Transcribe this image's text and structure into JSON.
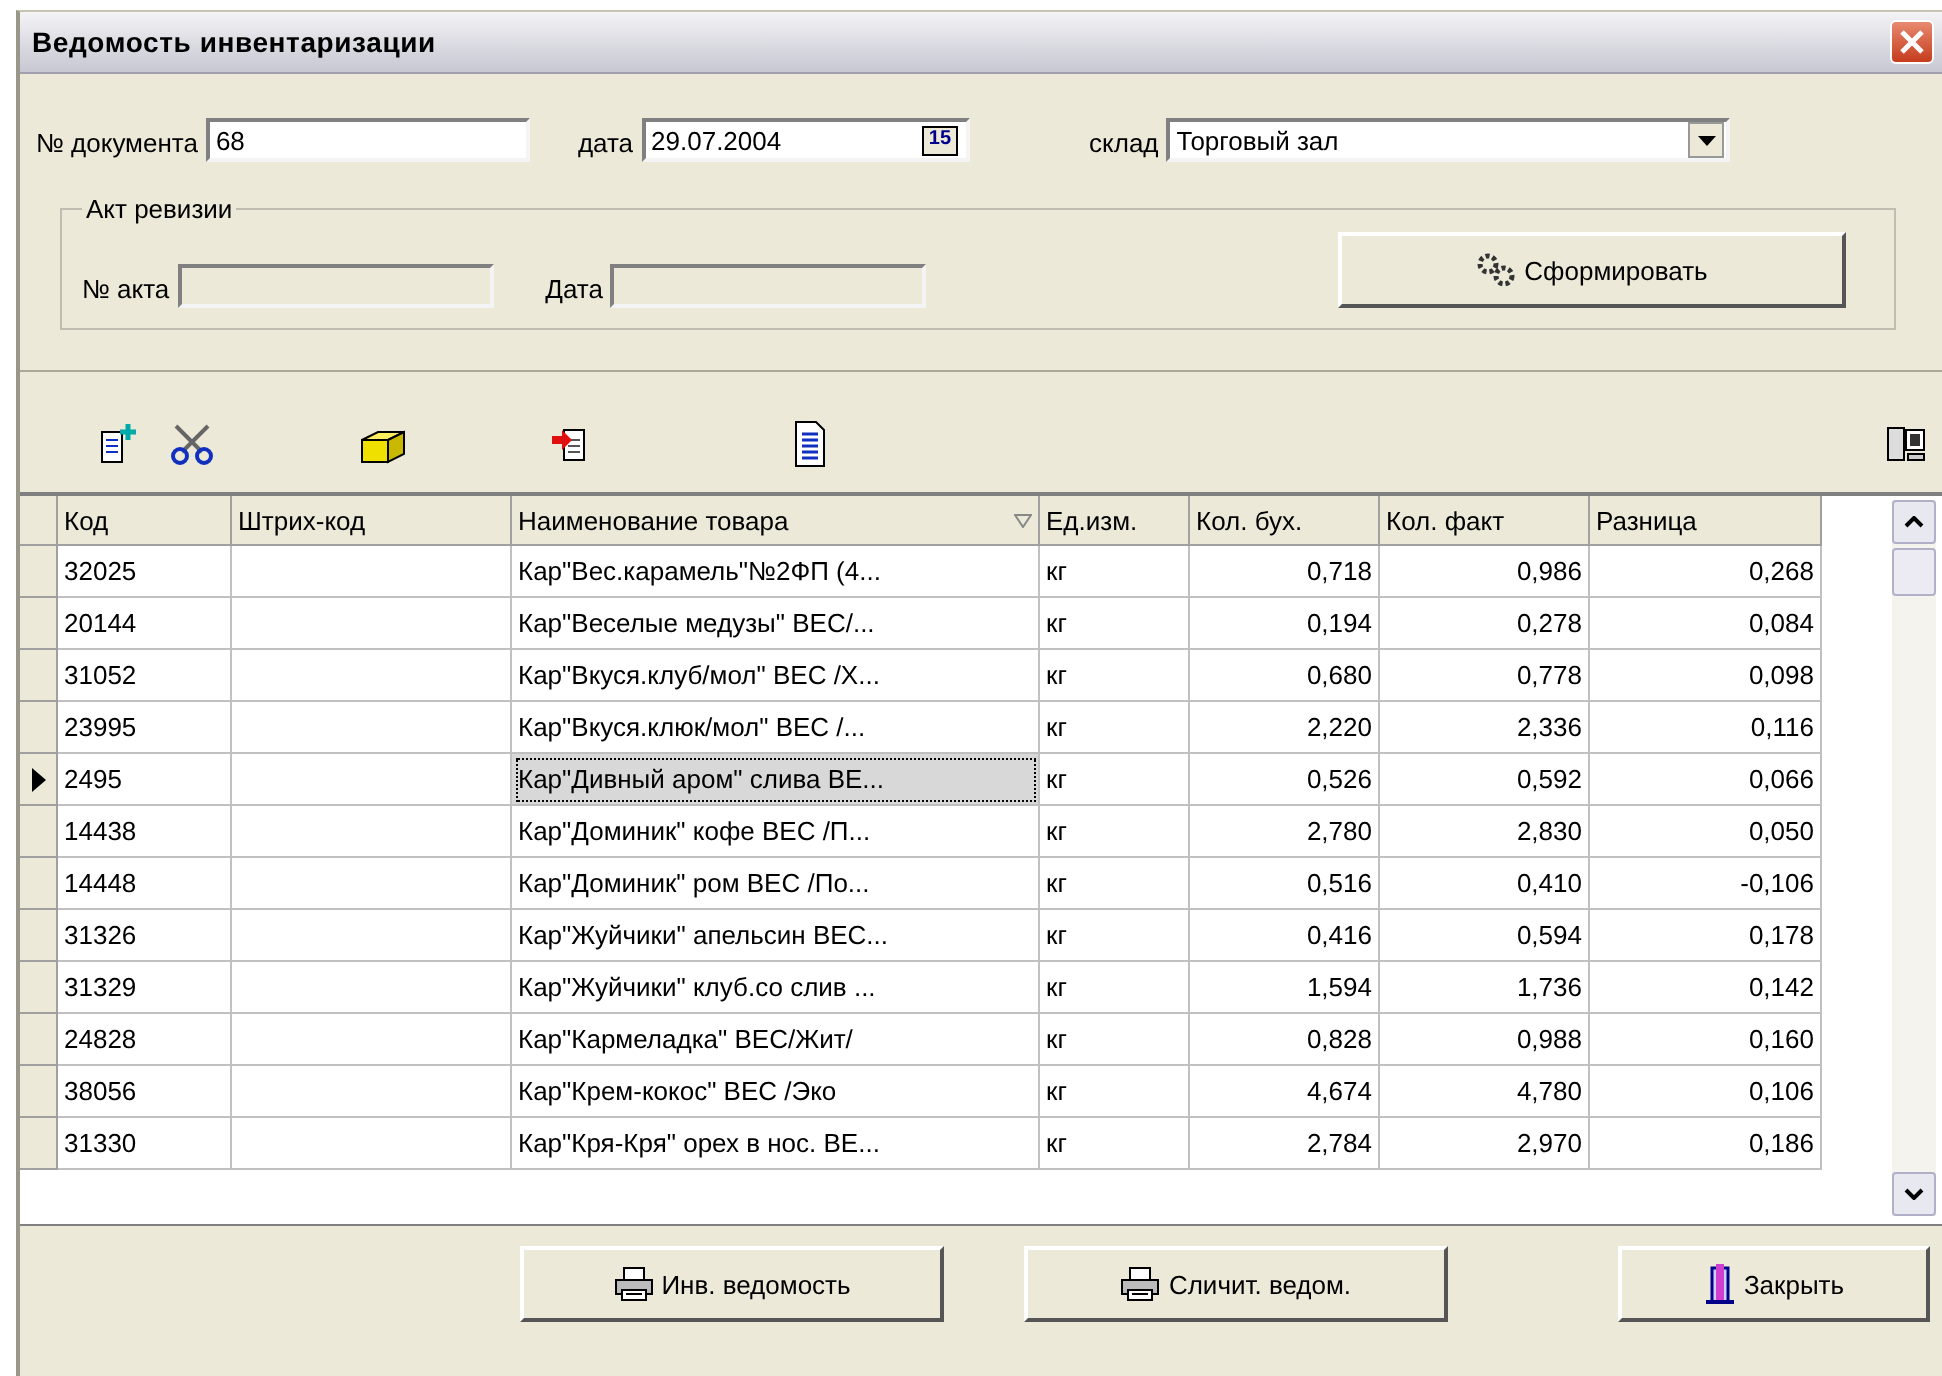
{
  "window": {
    "title": "Ведомость инвентаризации"
  },
  "header": {
    "doc_label": "№ документа",
    "doc_value": "68",
    "date_label": "дата",
    "date_value": "29.07.2004",
    "calendar_day": "15",
    "store_label": "склад",
    "store_value": "Торговый зал"
  },
  "audit": {
    "legend": "Акт ревизии",
    "act_label": "№ акта",
    "date_label": "Дата",
    "form_button": "Сформировать"
  },
  "table": {
    "columns": [
      {
        "label": "Код",
        "sorted": false
      },
      {
        "label": "Штрих-код",
        "sorted": false
      },
      {
        "label": "Наименование товара",
        "sorted": true
      },
      {
        "label": "Ед.изм.",
        "sorted": false
      },
      {
        "label": "Кол. бух.",
        "sorted": false
      },
      {
        "label": "Кол. факт",
        "sorted": false
      },
      {
        "label": "Разница",
        "sorted": false
      }
    ],
    "rows": [
      {
        "cells": [
          "32025",
          "",
          "Кар\"Вес.карамель\"№2ФП (4...",
          "кг",
          "0,718",
          "0,986",
          "0,268"
        ],
        "selected": false
      },
      {
        "cells": [
          "20144",
          "",
          "Кар\"Веселые медузы\" ВЕС/...",
          "кг",
          "0,194",
          "0,278",
          "0,084"
        ],
        "selected": false
      },
      {
        "cells": [
          "31052",
          "",
          "Кар\"Вкуся.клуб/мол\" ВЕС /Х...",
          "кг",
          "0,680",
          "0,778",
          "0,098"
        ],
        "selected": false
      },
      {
        "cells": [
          "23995",
          "",
          "Кар\"Вкуся.клюк/мол\" ВЕС /...",
          "кг",
          "2,220",
          "2,336",
          "0,116"
        ],
        "selected": false
      },
      {
        "cells": [
          "2495",
          "",
          "Кар\"Дивный аром\" слива ВЕ...",
          "кг",
          "0,526",
          "0,592",
          "0,066"
        ],
        "selected": true
      },
      {
        "cells": [
          "14438",
          "",
          "Кар\"Доминик\" кофе ВЕС /П...",
          "кг",
          "2,780",
          "2,830",
          "0,050"
        ],
        "selected": false
      },
      {
        "cells": [
          "14448",
          "",
          "Кар\"Доминик\" ром ВЕС /По...",
          "кг",
          "0,516",
          "0,410",
          "-0,106"
        ],
        "selected": false
      },
      {
        "cells": [
          "31326",
          "",
          "Кар\"Жуйчики\" апельсин ВЕС...",
          "кг",
          "0,416",
          "0,594",
          "0,178"
        ],
        "selected": false
      },
      {
        "cells": [
          "31329",
          "",
          "Кар\"Жуйчики\" клуб.со слив ...",
          "кг",
          "1,594",
          "1,736",
          "0,142"
        ],
        "selected": false
      },
      {
        "cells": [
          "24828",
          "",
          "Кар\"Кармеладка\" ВЕС/Жит/",
          "кг",
          "0,828",
          "0,988",
          "0,160"
        ],
        "selected": false
      },
      {
        "cells": [
          "38056",
          "",
          "Кар\"Крем-кокос\" ВЕС /Эко",
          "кг",
          "4,674",
          "4,780",
          "0,106"
        ],
        "selected": false
      },
      {
        "cells": [
          "31330",
          "",
          "Кар\"Кря-Кря\" орех в нос. ВЕ...",
          "кг",
          "2,784",
          "2,970",
          "0,186"
        ],
        "selected": false
      }
    ]
  },
  "buttons": [
    "Инв. ведомость",
    "Сличит. ведом.",
    "Закрыть"
  ]
}
